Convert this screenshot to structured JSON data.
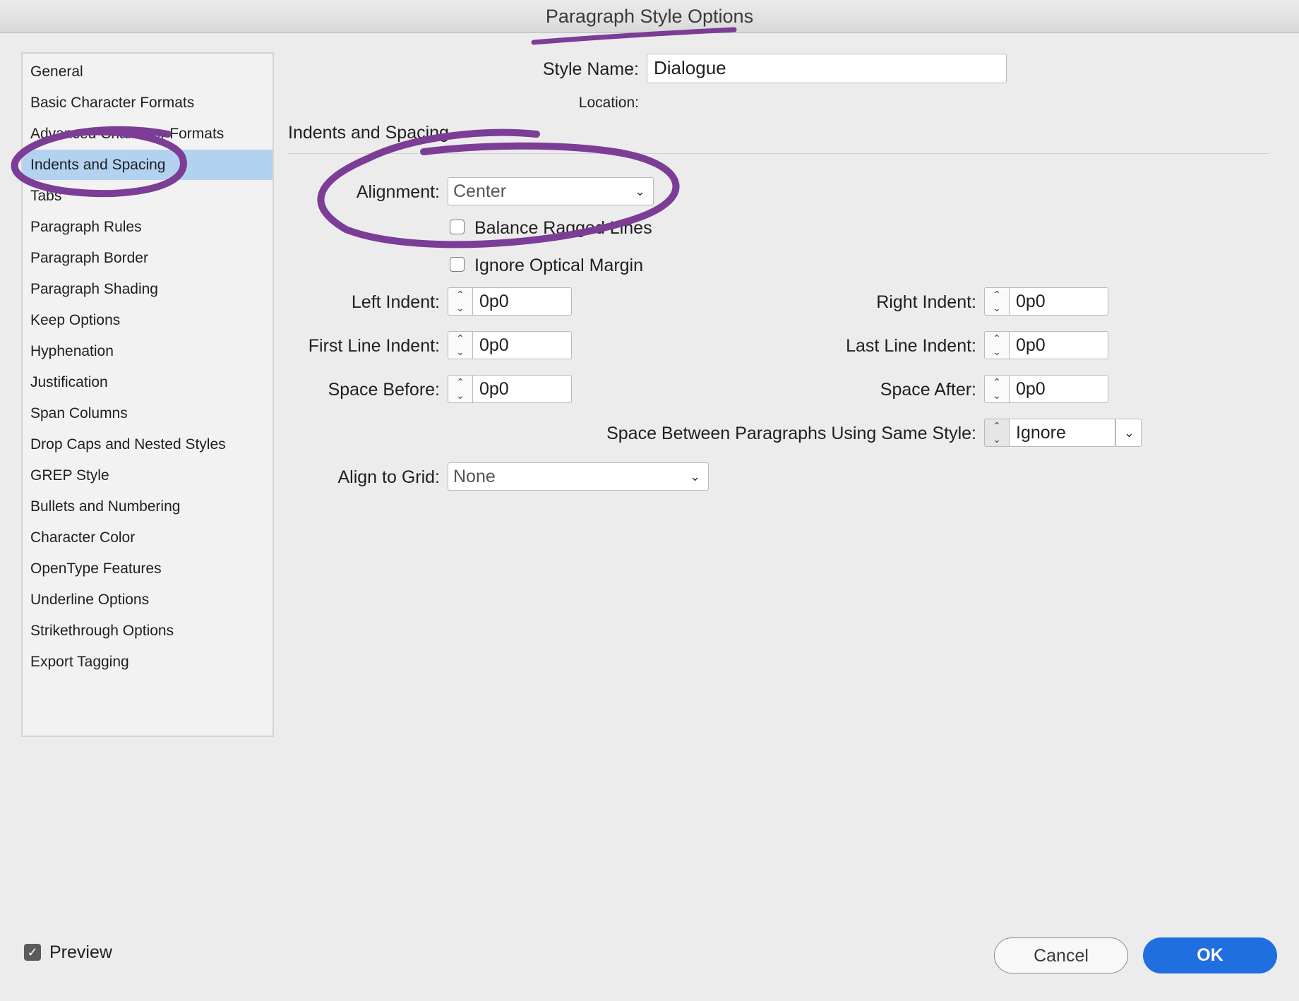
{
  "window": {
    "title": "Paragraph Style Options"
  },
  "sidebar": {
    "items": [
      {
        "label": "General"
      },
      {
        "label": "Basic Character Formats"
      },
      {
        "label": "Advanced Character Formats"
      },
      {
        "label": "Indents and Spacing",
        "selected": true
      },
      {
        "label": "Tabs"
      },
      {
        "label": "Paragraph Rules"
      },
      {
        "label": "Paragraph Border"
      },
      {
        "label": "Paragraph Shading"
      },
      {
        "label": "Keep Options"
      },
      {
        "label": "Hyphenation"
      },
      {
        "label": "Justification"
      },
      {
        "label": "Span Columns"
      },
      {
        "label": "Drop Caps and Nested Styles"
      },
      {
        "label": "GREP Style"
      },
      {
        "label": "Bullets and Numbering"
      },
      {
        "label": "Character Color"
      },
      {
        "label": "OpenType Features"
      },
      {
        "label": "Underline Options"
      },
      {
        "label": "Strikethrough Options"
      },
      {
        "label": "Export Tagging"
      }
    ]
  },
  "header": {
    "style_name_label": "Style Name:",
    "style_name_value": "Dialogue",
    "location_label": "Location:"
  },
  "section": {
    "title": "Indents and Spacing"
  },
  "alignment": {
    "label": "Alignment:",
    "value": "Center"
  },
  "options": {
    "balance_ragged_lines": {
      "label": "Balance Ragged Lines",
      "checked": false
    },
    "ignore_optical_margin": {
      "label": "Ignore Optical Margin",
      "checked": false
    }
  },
  "fields": {
    "left_indent": {
      "label": "Left Indent:",
      "value": "0p0"
    },
    "right_indent": {
      "label": "Right Indent:",
      "value": "0p0"
    },
    "first_line_indent": {
      "label": "First Line Indent:",
      "value": "0p0"
    },
    "last_line_indent": {
      "label": "Last Line Indent:",
      "value": "0p0"
    },
    "space_before": {
      "label": "Space Before:",
      "value": "0p0"
    },
    "space_after": {
      "label": "Space After:",
      "value": "0p0"
    },
    "space_between": {
      "label": "Space Between Paragraphs Using Same Style:",
      "value": "Ignore"
    }
  },
  "align_to_grid": {
    "label": "Align to Grid:",
    "value": "None"
  },
  "footer": {
    "preview_label": "Preview",
    "preview_checked": true,
    "cancel_label": "Cancel",
    "ok_label": "OK"
  },
  "colors": {
    "annotation": "#7b3d96",
    "selection": "#b3d2f0",
    "ok_button": "#1f6fe0"
  },
  "icons": {
    "stepper": "stepper-icon",
    "dropdown": "chevron-down-icon",
    "checkbox": "checkbox-icon"
  }
}
